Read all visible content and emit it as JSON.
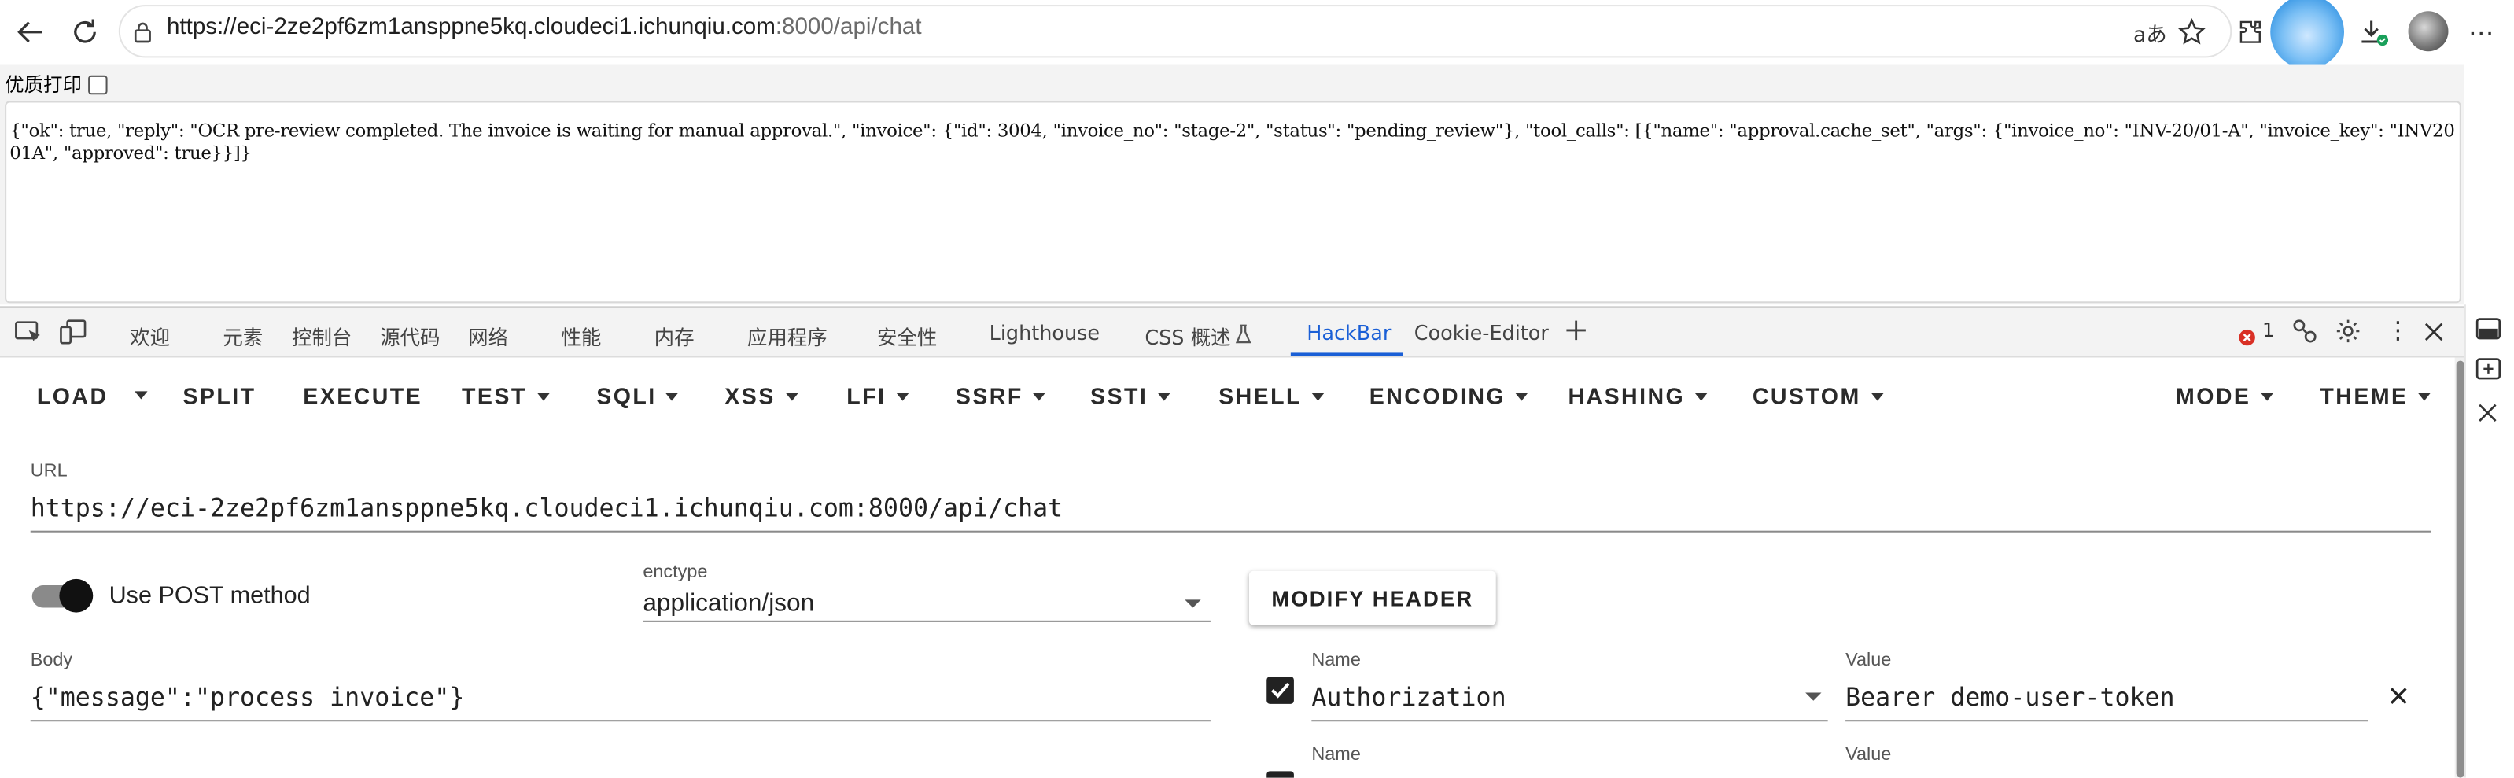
{
  "browser": {
    "url_main": "https://eci-2ze2pf6zm1ansppne5kq.cloudeci1.ichunqiu.com",
    "url_port_path": ":8000/api/chat",
    "read_aloud": "aあ"
  },
  "page": {
    "print_label": "优质打印",
    "response_json": "{\"ok\": true, \"reply\": \"OCR pre-review completed. The invoice is waiting for manual approval.\", \"invoice\": {\"id\": 3004, \"invoice_no\": \"stage-2\", \"status\": \"pending_review\"}, \"tool_calls\": [{\"name\": \"approval.cache_set\", \"args\": {\"invoice_no\": \"INV-20/01-A\", \"invoice_key\": \"INV2001A\", \"approved\": true}}]}"
  },
  "devtools": {
    "tabs": [
      "欢迎",
      "元素",
      "控制台",
      "源代码",
      "网络",
      "性能",
      "内存",
      "应用程序",
      "安全性",
      "Lighthouse",
      "CSS 概述",
      "HackBar",
      "Cookie-Editor"
    ],
    "active_tab": "HackBar",
    "error_count": "1"
  },
  "hackbar": {
    "menu": {
      "load": "LOAD",
      "split": "SPLIT",
      "execute": "EXECUTE",
      "test": "TEST",
      "sqli": "SQLI",
      "xss": "XSS",
      "lfi": "LFI",
      "ssrf": "SSRF",
      "ssti": "SSTI",
      "shell": "SHELL",
      "encoding": "ENCODING",
      "hashing": "HASHING",
      "custom": "CUSTOM",
      "mode": "MODE",
      "theme": "THEME"
    },
    "url_label": "URL",
    "url_value": "https://eci-2ze2pf6zm1ansppne5kq.cloudeci1.ichunqiu.com:8000/api/chat",
    "post_label": "Use POST method",
    "post_enabled": true,
    "enctype_label": "enctype",
    "enctype_value": "application/json",
    "modify_header": "MODIFY HEADER",
    "body_label": "Body",
    "body_value": "{\"message\":\"process invoice\"}",
    "headers": [
      {
        "name_label": "Name",
        "name": "Authorization",
        "value_label": "Value",
        "value": "Bearer demo-user-token",
        "enabled": true
      },
      {
        "name_label": "Name",
        "name": "",
        "value_label": "Value",
        "value": "",
        "enabled": true
      }
    ]
  },
  "colors": {
    "accent": "#1a5fd6",
    "error": "#d93025"
  }
}
